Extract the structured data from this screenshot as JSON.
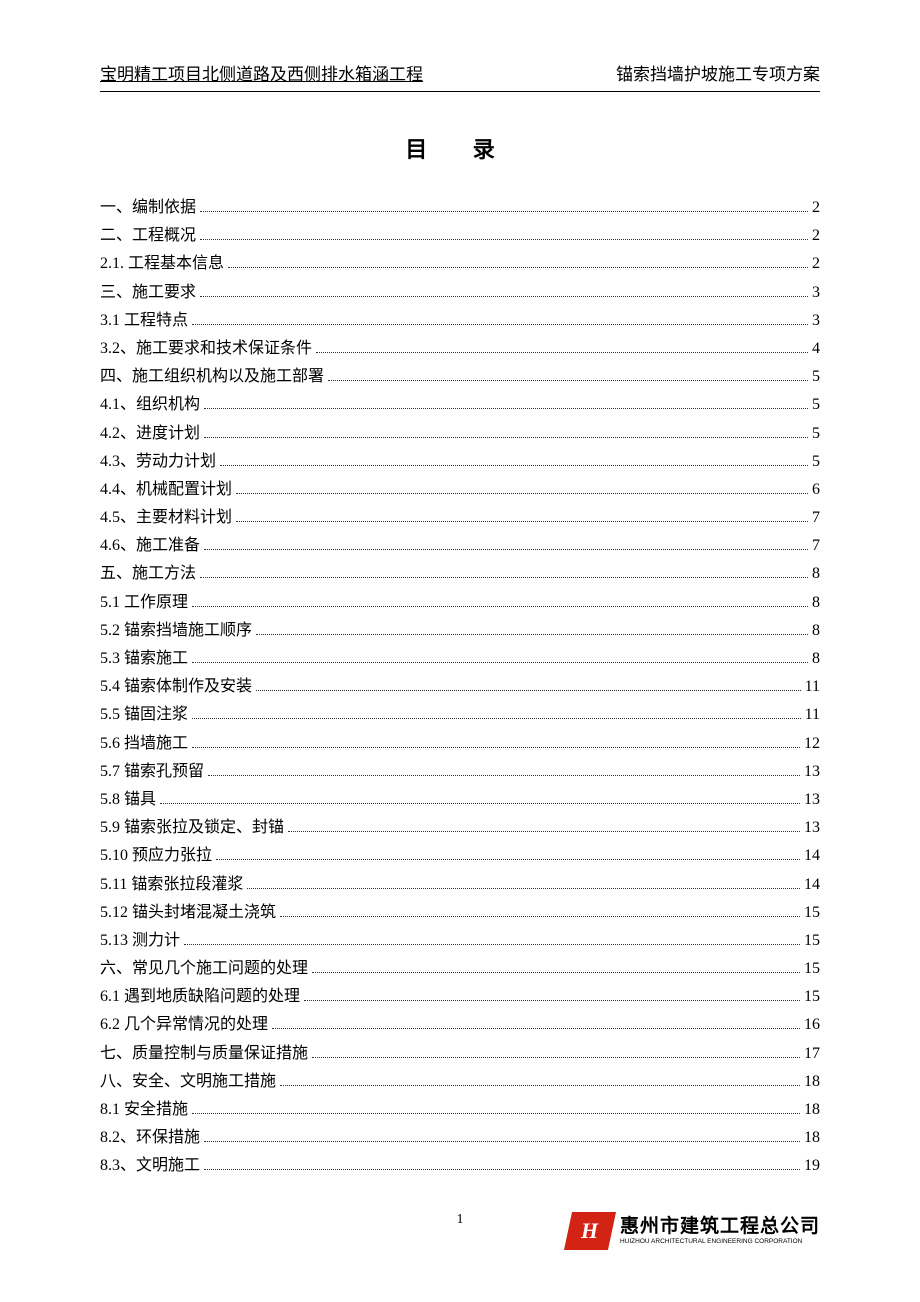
{
  "header": {
    "left": "宝明精工项目北侧道路及西侧排水箱涵工程",
    "right": "锚索挡墙护坡施工专项方案"
  },
  "toc_title": "目 录",
  "toc": [
    {
      "label": "一、编制依据",
      "page": "2"
    },
    {
      "label": "二、工程概况",
      "page": "2"
    },
    {
      "label": "2.1. 工程基本信息",
      "page": "2"
    },
    {
      "label": "三、施工要求",
      "page": "3"
    },
    {
      "label": "3.1 工程特点",
      "page": "3"
    },
    {
      "label": "3.2、施工要求和技术保证条件",
      "page": "4"
    },
    {
      "label": "四、施工组织机构以及施工部署",
      "page": "5"
    },
    {
      "label": "4.1、组织机构",
      "page": "5"
    },
    {
      "label": "4.2、进度计划",
      "page": "5"
    },
    {
      "label": "4.3、劳动力计划",
      "page": "5"
    },
    {
      "label": "4.4、机械配置计划",
      "page": "6"
    },
    {
      "label": "4.5、主要材料计划",
      "page": "7"
    },
    {
      "label": "4.6、施工准备",
      "page": "7"
    },
    {
      "label": "五、施工方法",
      "page": "8"
    },
    {
      "label": "5.1 工作原理",
      "page": "8"
    },
    {
      "label": "5.2 锚索挡墙施工顺序",
      "page": "8"
    },
    {
      "label": "5.3 锚索施工",
      "page": "8"
    },
    {
      "label": "5.4 锚索体制作及安装",
      "page": "11"
    },
    {
      "label": "5.5 锚固注浆",
      "page": "11"
    },
    {
      "label": "5.6 挡墙施工",
      "page": "12"
    },
    {
      "label": "5.7 锚索孔预留",
      "page": "13"
    },
    {
      "label": "5.8 锚具",
      "page": "13"
    },
    {
      "label": "5.9 锚索张拉及锁定、封锚",
      "page": "13"
    },
    {
      "label": "5.10 预应力张拉",
      "page": "14"
    },
    {
      "label": "5.11 锚索张拉段灌浆",
      "page": "14"
    },
    {
      "label": "5.12 锚头封堵混凝土浇筑",
      "page": "15"
    },
    {
      "label": "5.13 测力计",
      "page": "15"
    },
    {
      "label": "六、常见几个施工问题的处理",
      "page": "15"
    },
    {
      "label": "6.1 遇到地质缺陷问题的处理",
      "page": "15"
    },
    {
      "label": "6.2 几个异常情况的处理",
      "page": "16"
    },
    {
      "label": "七、质量控制与质量保证措施",
      "page": "17"
    },
    {
      "label": "八、安全、文明施工措施",
      "page": "18"
    },
    {
      "label": "8.1 安全措施",
      "page": "18"
    },
    {
      "label": "8.2、环保措施",
      "page": "18"
    },
    {
      "label": "8.3、文明施工",
      "page": "19"
    }
  ],
  "page_number": "1",
  "company": {
    "logo_text": "H",
    "cn": "惠州市建筑工程总公司",
    "en": "HUIZHOU ARCHITECTURAL ENGINEERING CORPORATION"
  }
}
